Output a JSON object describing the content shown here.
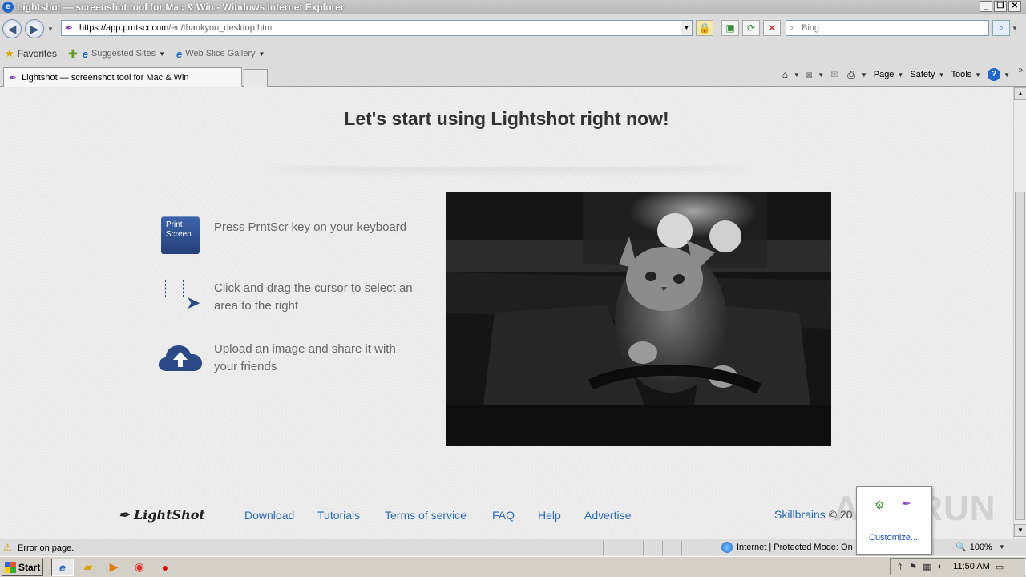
{
  "window": {
    "title": "Lightshot — screenshot tool for Mac & Win - Windows Internet Explorer",
    "minimize": "_",
    "restore": "❐",
    "close": "✕"
  },
  "address_bar": {
    "url_host": "https://app.prntscr.com",
    "url_path": "/en/thankyou_desktop.html",
    "search_placeholder": "Bing"
  },
  "favorites_bar": {
    "favorites_label": "Favorites",
    "suggested_sites": "Suggested Sites",
    "web_slice_gallery": "Web Slice Gallery"
  },
  "tab": {
    "label": "Lightshot — screenshot tool for Mac & Win"
  },
  "command_bar": {
    "page": "Page",
    "safety": "Safety",
    "tools": "Tools"
  },
  "page": {
    "subheading": "Let's start using Lightshot right now!",
    "steps": [
      {
        "icon_text": "Print Screen",
        "text": "Press PrntScr key on your keyboard"
      },
      {
        "text": "Click and drag the cursor to select an area to the right"
      },
      {
        "text": "Upload an image and share it with your friends"
      }
    ],
    "footer": {
      "logo": "LightShot",
      "links": [
        "Download",
        "Tutorials",
        "Terms of service",
        "FAQ",
        "Help",
        "Advertise"
      ],
      "company": "Skillbrains",
      "copyright": " © 20"
    }
  },
  "status_bar": {
    "message": "Error on page.",
    "zone": "Internet | Protected Mode: On",
    "zoom": "100%"
  },
  "notification": {
    "customize": "Customize..."
  },
  "watermark": "ANY.RUN",
  "taskbar": {
    "start": "Start",
    "clock": "11:50 AM"
  },
  "icons": {
    "back": "back-arrow-icon",
    "forward": "forward-arrow-icon",
    "lock": "lock-icon",
    "refresh": "refresh-icon",
    "stop": "stop-icon",
    "home": "home-icon",
    "rss": "rss-icon",
    "print": "print-icon",
    "help": "help-icon"
  },
  "colors": {
    "link": "#2a6db5",
    "heading": "#333333",
    "key_icon": "#2f4f8f",
    "window_bg": "#dcdcdc"
  }
}
